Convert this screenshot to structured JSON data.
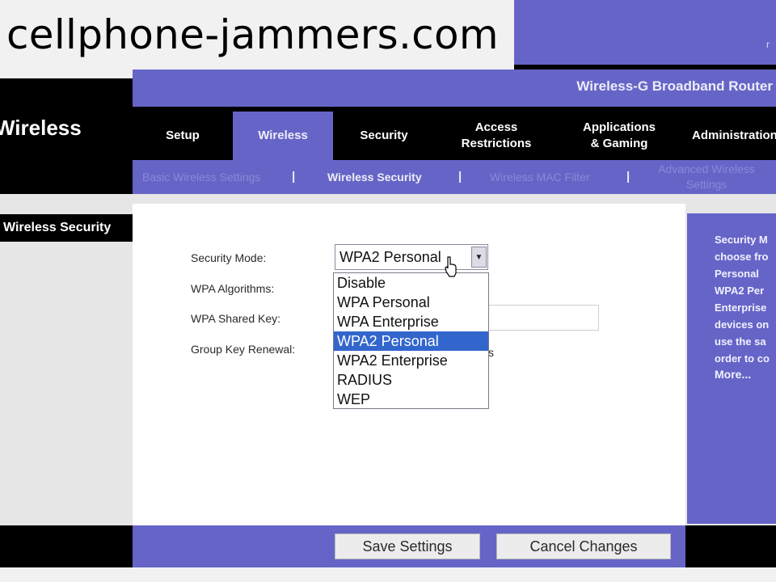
{
  "watermark": "cellphone-jammers.com",
  "top_right_fragment": "r",
  "product_name": "Wireless-G Broadband Router",
  "section_title": "Wireless",
  "main_tabs": [
    {
      "label": "Setup"
    },
    {
      "label": "Wireless"
    },
    {
      "label": "Security"
    },
    {
      "label": "Access\nRestrictions"
    },
    {
      "label": "Applications\n& Gaming"
    },
    {
      "label": "Administration"
    }
  ],
  "sub_tabs": [
    {
      "label": "Basic Wireless Settings"
    },
    {
      "label": "Wireless Security"
    },
    {
      "label": "Wireless MAC Filter"
    },
    {
      "label": "Advanced Wireless\nSettings"
    }
  ],
  "sub_separator": "|",
  "left_nav_label": "Wireless Security",
  "form": {
    "security_mode_label": "Security Mode:",
    "security_mode_value": "WPA2 Personal",
    "wpa_algorithms_label": "WPA Algorithms:",
    "shared_key_label": "WPA Shared  Key:",
    "group_key_label": "Group Key  Renewal:",
    "renewal_suffix": "s"
  },
  "dropdown_options": [
    "Disable",
    "WPA Personal",
    "WPA Enterprise",
    "WPA2 Personal",
    "WPA2 Enterprise",
    "RADIUS",
    "WEP"
  ],
  "dropdown_selected": "WPA2 Personal",
  "help": {
    "text": "Security M\nchoose fro\nPersonal\nWPA2 Per\nEnterprise\ndevices on\nuse the sa\norder to co",
    "more_link": "More..."
  },
  "buttons": {
    "save": "Save Settings",
    "cancel": "Cancel Changes"
  },
  "colors": {
    "brand_purple": "#6665c7",
    "highlight": "#3366cc"
  }
}
